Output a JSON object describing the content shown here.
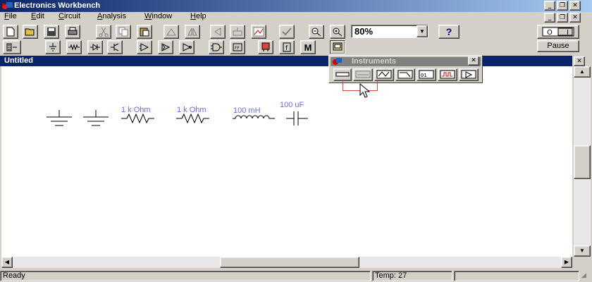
{
  "app": {
    "title": "Electronics Workbench"
  },
  "menu": [
    {
      "label": "File",
      "u": "F",
      "rest": "ile"
    },
    {
      "label": "Edit",
      "u": "E",
      "rest": "dit"
    },
    {
      "label": "Circuit",
      "u": "C",
      "rest": "ircuit"
    },
    {
      "label": "Analysis",
      "u": "A",
      "rest": "nalysis"
    },
    {
      "label": "Window",
      "u": "W",
      "rest": "indow"
    },
    {
      "label": "Help",
      "u": "H",
      "rest": "elp"
    }
  ],
  "toolbar": {
    "zoom_value": "80%",
    "help_label": "?",
    "pause_label": "Pause",
    "m_label": "M"
  },
  "document": {
    "title": "Untitled"
  },
  "components": {
    "resistor1_label": "1 k Ohm",
    "resistor2_label": "1 k Ohm",
    "inductor_label": "100 mH",
    "capacitor_label": "100 uF"
  },
  "instruments": {
    "title": "Instruments",
    "close": "✕"
  },
  "status": {
    "state": "Ready",
    "temp": "Temp: 27"
  }
}
